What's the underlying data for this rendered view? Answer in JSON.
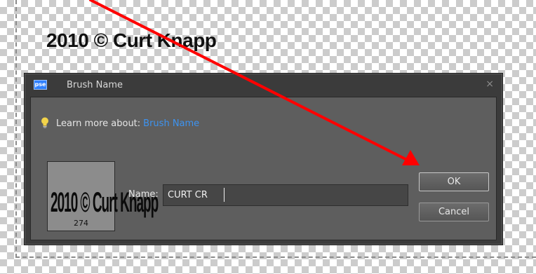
{
  "watermark": {
    "text": "2010 © Curt Knapp"
  },
  "dialog": {
    "app_badge": "pse",
    "title": "Brush Name",
    "close_glyph": "×",
    "help": {
      "prefix": "Learn more about:",
      "link": "Brush Name"
    },
    "preview": {
      "stroke_text": "2010 © Curt Knapp",
      "size": "274"
    },
    "name": {
      "label": "Name:",
      "value": "CURT CR"
    },
    "buttons": {
      "ok": "OK",
      "cancel": "Cancel"
    }
  },
  "colors": {
    "annotation_arrow": "#ff0000",
    "link": "#3d93f0",
    "dialog_bg": "#3b3b3b",
    "content_bg": "#5e5e5e"
  },
  "icons": {
    "app": "pse-app-icon",
    "help": "lightbulb-icon",
    "close": "close-icon"
  }
}
